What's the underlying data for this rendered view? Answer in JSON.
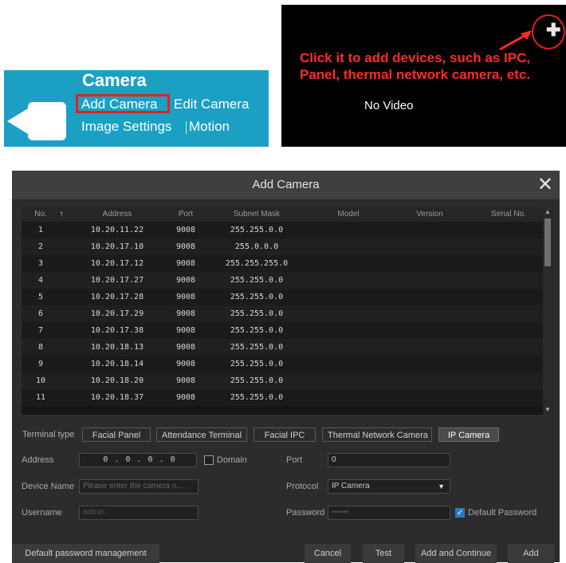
{
  "camera_menu": {
    "title": "Camera",
    "add_camera": "Add Camera",
    "edit_camera": "Edit Camera",
    "image_settings": "Image Settings",
    "motion": "Motion"
  },
  "video_panel": {
    "callout": "Click  it to add devices, such as IPC,  Panel,  thermal network camera, etc.",
    "no_video": "No Video",
    "add_icon": "plus-icon"
  },
  "dialog": {
    "title": "Add Camera",
    "close_glyph": "✕",
    "columns": [
      "No.",
      "Address",
      "Port",
      "Subnet Mask",
      "Model",
      "Version",
      "Serial No."
    ],
    "sort_glyph": "↑",
    "rows": [
      {
        "no": "1",
        "address": "10.20.11.22",
        "port": "9008",
        "mask": "255.255.0.0"
      },
      {
        "no": "2",
        "address": "10.20.17.10",
        "port": "9008",
        "mask": "255.0.0.0"
      },
      {
        "no": "3",
        "address": "10.20.17.12",
        "port": "9008",
        "mask": "255.255.255.0"
      },
      {
        "no": "4",
        "address": "10.20.17.27",
        "port": "9008",
        "mask": "255.255.0.0"
      },
      {
        "no": "5",
        "address": "10.20.17.28",
        "port": "9008",
        "mask": "255.255.0.0"
      },
      {
        "no": "6",
        "address": "10.20.17.29",
        "port": "9008",
        "mask": "255.255.0.0"
      },
      {
        "no": "7",
        "address": "10.20.17.38",
        "port": "9008",
        "mask": "255.255.0.0"
      },
      {
        "no": "8",
        "address": "10.20.18.13",
        "port": "9008",
        "mask": "255.255.0.0"
      },
      {
        "no": "9",
        "address": "10.20.18.14",
        "port": "9008",
        "mask": "255.255.0.0"
      },
      {
        "no": "10",
        "address": "10.20.18.20",
        "port": "9008",
        "mask": "255.255.0.0"
      },
      {
        "no": "11",
        "address": "10.20.18.37",
        "port": "9008",
        "mask": "255.255.0.0"
      }
    ],
    "terminal_type_label": "Terminal type",
    "terminal_types": [
      "Facial Panel",
      "Attendance Terminal",
      "Facial IPC",
      "Thermal Network Camera",
      "IP Camera"
    ],
    "active_terminal_type": "IP Camera",
    "address_label": "Address",
    "address_value": "0  .  0  .  0  .  0",
    "domain_label": "Domain",
    "port_label": "Port",
    "port_value": "0",
    "device_name_label": "Device Name",
    "device_name_placeholder": "Please enter the camera n...",
    "protocol_label": "Protocol",
    "protocol_value": "IP Camera",
    "username_label": "Username",
    "username_value": "admin",
    "password_label": "Password",
    "password_value": "••••••",
    "default_password_label": "Default Password",
    "default_password_checked": true,
    "buttons": {
      "default_password_management": "Default password management",
      "cancel": "Cancel",
      "test": "Test",
      "add_and_continue": "Add and Continue",
      "add": "Add"
    }
  },
  "colors": {
    "panel_blue": "#1ba0c4",
    "callout_red": "#ff2a2a",
    "dialog_bg": "#2c2c2c",
    "checkbox_blue": "#2f79c6"
  }
}
